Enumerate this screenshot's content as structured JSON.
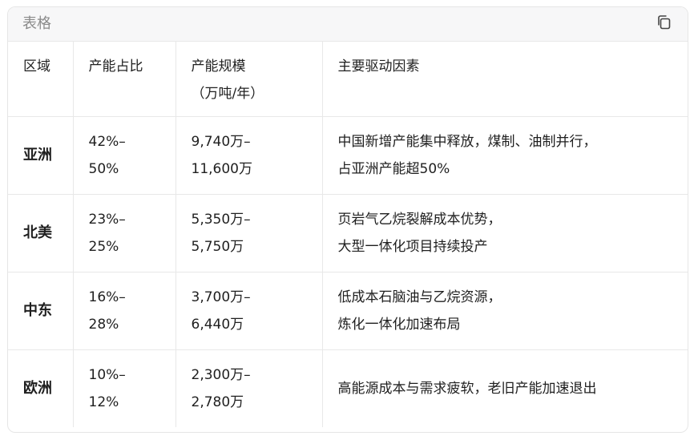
{
  "card": {
    "title": "表格",
    "copy_icon": "copy-icon"
  },
  "table": {
    "headers": {
      "region": "区域",
      "share": "产能占比",
      "scale_line1": "产能规模",
      "scale_line2": "（万吨/年）",
      "drivers": "主要驱动因素"
    },
    "rows": [
      {
        "region": "亚洲",
        "share_line1": "42%–",
        "share_line2": "50%",
        "scale_line1": "9,740万–",
        "scale_line2": "11,600万",
        "drivers_line1": "中国新增产能集中释放，煤制、油制并行，",
        "drivers_line2": "占亚洲产能超50%"
      },
      {
        "region": "北美",
        "share_line1": "23%–",
        "share_line2": "25%",
        "scale_line1": "5,350万–",
        "scale_line2": "5,750万",
        "drivers_line1": "页岩气乙烷裂解成本优势，",
        "drivers_line2": "大型一体化项目持续投产"
      },
      {
        "region": "中东",
        "share_line1": "16%–",
        "share_line2": "28%",
        "scale_line1": "3,700万–",
        "scale_line2": "6,440万",
        "drivers_line1": "低成本石脑油与乙烷资源，",
        "drivers_line2": "炼化一体化加速布局"
      },
      {
        "region": "欧洲",
        "share_line1": "10%–",
        "share_line2": "12%",
        "scale_line1": "2,300万–",
        "scale_line2": "2,780万",
        "drivers_line1": "高能源成本与需求疲软，老旧产能加速退出",
        "drivers_line2": ""
      }
    ]
  }
}
